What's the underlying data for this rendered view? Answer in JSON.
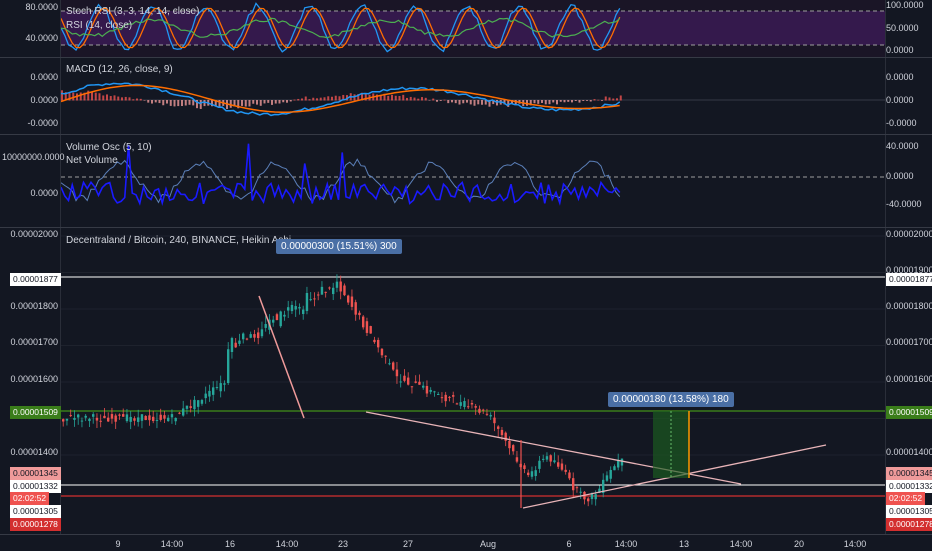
{
  "stoch_pane": {
    "title": "Stoch RSI (3, 3, 14, 14, close)",
    "subtitle": "RSI (14, close)",
    "left_ticks": [
      "80.0000",
      "40.0000"
    ],
    "right_ticks": [
      "100.0000",
      "50.0000",
      "0.0000"
    ]
  },
  "macd_pane": {
    "title": "MACD (12, 26, close, 9)",
    "left_ticks": [
      "0.0000",
      "0.0000",
      "-0.0000"
    ],
    "right_ticks": [
      "0.0000",
      "0.0000",
      "-0.0000"
    ]
  },
  "volume_pane": {
    "title": "Volume Osc (5, 10)",
    "subtitle": "Net Volume",
    "left_ticks": [
      "10000000.0000",
      "0.0000"
    ],
    "right_ticks": [
      "40.0000",
      "0.0000",
      "-40.0000"
    ]
  },
  "price_pane": {
    "title": "Decentraland / Bitcoin, 240, BINANCE, Heikin Ashi",
    "left_ticks": [
      "0.00002000",
      "0.00001800",
      "0.00001700",
      "0.00001600",
      "0.00001400"
    ],
    "right_ticks": [
      "0.00002000",
      "0.00001900",
      "0.00001800",
      "0.00001700",
      "0.00001600",
      "0.00001400"
    ],
    "left_tags": {
      "high": "0.00001877",
      "support": "0.00001509",
      "a": "0.00001345",
      "b": "0.00001332",
      "timer": "02:02:52",
      "c": "0.00001305",
      "low": "0.00001278"
    },
    "right_tags": {
      "high": "0.00001877",
      "support": "0.00001509",
      "a": "0.00001345",
      "b": "0.00001332",
      "timer": "02:02:52",
      "c": "0.00001305",
      "low": "0.00001278"
    },
    "callout_top": "0.00000300 (15.51%) 300",
    "callout_right": "0.00000180 (13.58%) 180"
  },
  "x_axis": [
    "9",
    "14:00",
    "16",
    "14:00",
    "23",
    "27",
    "Aug",
    "6",
    "14:00",
    "13",
    "14:00",
    "20",
    "14:00"
  ],
  "colors": {
    "background": "#131722",
    "up": "#26a69a",
    "down": "#ef5350",
    "macd": "#2196f3",
    "signal": "#ff6d00",
    "support_line": "#3a7d1a",
    "resistance_line": "#ffffff",
    "low_line": "#d32f2f",
    "stoch_fill": "#4a1e6b"
  }
}
